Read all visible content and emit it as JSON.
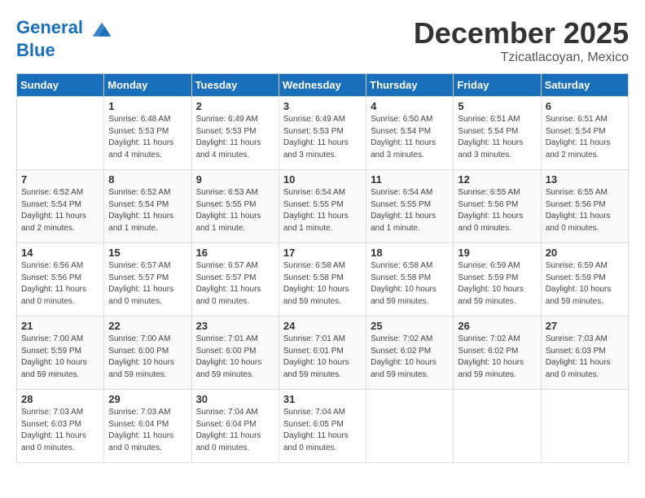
{
  "header": {
    "logo_line1": "General",
    "logo_line2": "Blue",
    "month": "December 2025",
    "location": "Tzicatlacoyan, Mexico"
  },
  "weekdays": [
    "Sunday",
    "Monday",
    "Tuesday",
    "Wednesday",
    "Thursday",
    "Friday",
    "Saturday"
  ],
  "weeks": [
    [
      {
        "day": "",
        "info": ""
      },
      {
        "day": "1",
        "info": "Sunrise: 6:48 AM\nSunset: 5:53 PM\nDaylight: 11 hours\nand 4 minutes."
      },
      {
        "day": "2",
        "info": "Sunrise: 6:49 AM\nSunset: 5:53 PM\nDaylight: 11 hours\nand 4 minutes."
      },
      {
        "day": "3",
        "info": "Sunrise: 6:49 AM\nSunset: 5:53 PM\nDaylight: 11 hours\nand 3 minutes."
      },
      {
        "day": "4",
        "info": "Sunrise: 6:50 AM\nSunset: 5:54 PM\nDaylight: 11 hours\nand 3 minutes."
      },
      {
        "day": "5",
        "info": "Sunrise: 6:51 AM\nSunset: 5:54 PM\nDaylight: 11 hours\nand 3 minutes."
      },
      {
        "day": "6",
        "info": "Sunrise: 6:51 AM\nSunset: 5:54 PM\nDaylight: 11 hours\nand 2 minutes."
      }
    ],
    [
      {
        "day": "7",
        "info": "Sunrise: 6:52 AM\nSunset: 5:54 PM\nDaylight: 11 hours\nand 2 minutes."
      },
      {
        "day": "8",
        "info": "Sunrise: 6:52 AM\nSunset: 5:54 PM\nDaylight: 11 hours\nand 1 minute."
      },
      {
        "day": "9",
        "info": "Sunrise: 6:53 AM\nSunset: 5:55 PM\nDaylight: 11 hours\nand 1 minute."
      },
      {
        "day": "10",
        "info": "Sunrise: 6:54 AM\nSunset: 5:55 PM\nDaylight: 11 hours\nand 1 minute."
      },
      {
        "day": "11",
        "info": "Sunrise: 6:54 AM\nSunset: 5:55 PM\nDaylight: 11 hours\nand 1 minute."
      },
      {
        "day": "12",
        "info": "Sunrise: 6:55 AM\nSunset: 5:56 PM\nDaylight: 11 hours\nand 0 minutes."
      },
      {
        "day": "13",
        "info": "Sunrise: 6:55 AM\nSunset: 5:56 PM\nDaylight: 11 hours\nand 0 minutes."
      }
    ],
    [
      {
        "day": "14",
        "info": "Sunrise: 6:56 AM\nSunset: 5:56 PM\nDaylight: 11 hours\nand 0 minutes."
      },
      {
        "day": "15",
        "info": "Sunrise: 6:57 AM\nSunset: 5:57 PM\nDaylight: 11 hours\nand 0 minutes."
      },
      {
        "day": "16",
        "info": "Sunrise: 6:57 AM\nSunset: 5:57 PM\nDaylight: 11 hours\nand 0 minutes."
      },
      {
        "day": "17",
        "info": "Sunrise: 6:58 AM\nSunset: 5:58 PM\nDaylight: 10 hours\nand 59 minutes."
      },
      {
        "day": "18",
        "info": "Sunrise: 6:58 AM\nSunset: 5:58 PM\nDaylight: 10 hours\nand 59 minutes."
      },
      {
        "day": "19",
        "info": "Sunrise: 6:59 AM\nSunset: 5:59 PM\nDaylight: 10 hours\nand 59 minutes."
      },
      {
        "day": "20",
        "info": "Sunrise: 6:59 AM\nSunset: 5:59 PM\nDaylight: 10 hours\nand 59 minutes."
      }
    ],
    [
      {
        "day": "21",
        "info": "Sunrise: 7:00 AM\nSunset: 5:59 PM\nDaylight: 10 hours\nand 59 minutes."
      },
      {
        "day": "22",
        "info": "Sunrise: 7:00 AM\nSunset: 6:00 PM\nDaylight: 10 hours\nand 59 minutes."
      },
      {
        "day": "23",
        "info": "Sunrise: 7:01 AM\nSunset: 6:00 PM\nDaylight: 10 hours\nand 59 minutes."
      },
      {
        "day": "24",
        "info": "Sunrise: 7:01 AM\nSunset: 6:01 PM\nDaylight: 10 hours\nand 59 minutes."
      },
      {
        "day": "25",
        "info": "Sunrise: 7:02 AM\nSunset: 6:02 PM\nDaylight: 10 hours\nand 59 minutes."
      },
      {
        "day": "26",
        "info": "Sunrise: 7:02 AM\nSunset: 6:02 PM\nDaylight: 10 hours\nand 59 minutes."
      },
      {
        "day": "27",
        "info": "Sunrise: 7:03 AM\nSunset: 6:03 PM\nDaylight: 11 hours\nand 0 minutes."
      }
    ],
    [
      {
        "day": "28",
        "info": "Sunrise: 7:03 AM\nSunset: 6:03 PM\nDaylight: 11 hours\nand 0 minutes."
      },
      {
        "day": "29",
        "info": "Sunrise: 7:03 AM\nSunset: 6:04 PM\nDaylight: 11 hours\nand 0 minutes."
      },
      {
        "day": "30",
        "info": "Sunrise: 7:04 AM\nSunset: 6:04 PM\nDaylight: 11 hours\nand 0 minutes."
      },
      {
        "day": "31",
        "info": "Sunrise: 7:04 AM\nSunset: 6:05 PM\nDaylight: 11 hours\nand 0 minutes."
      },
      {
        "day": "",
        "info": ""
      },
      {
        "day": "",
        "info": ""
      },
      {
        "day": "",
        "info": ""
      }
    ]
  ]
}
